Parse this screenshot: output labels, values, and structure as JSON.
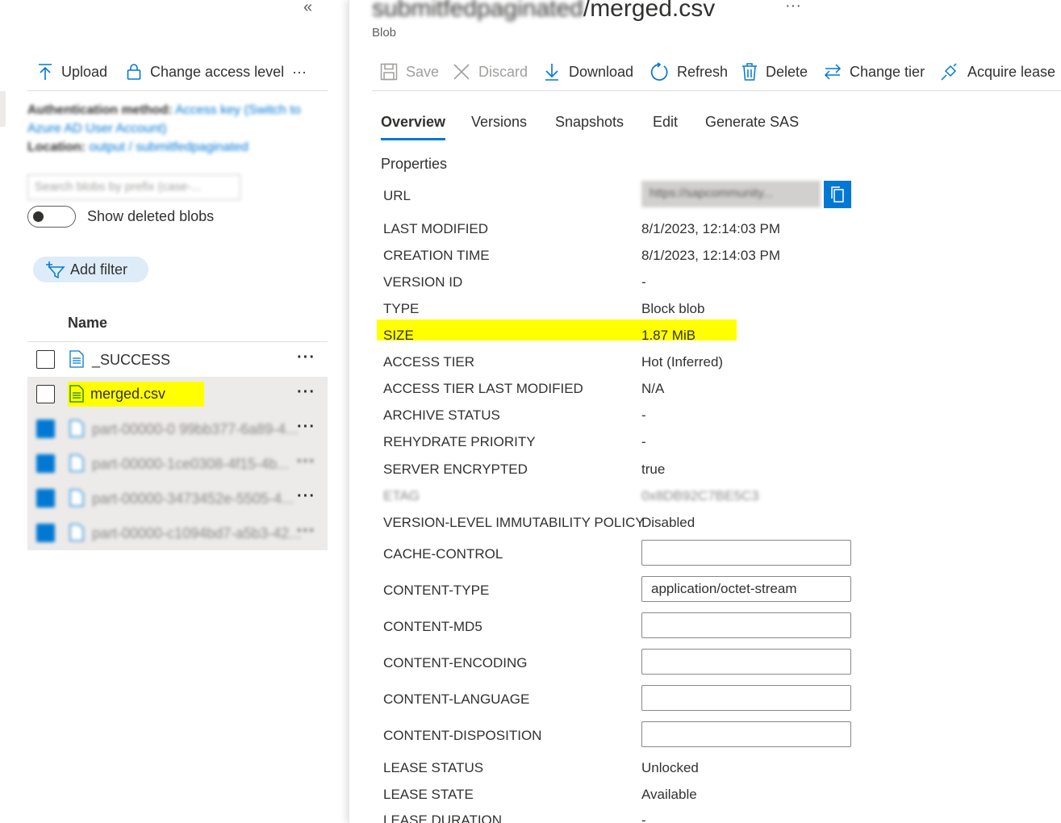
{
  "left": {
    "collapse_glyph": "«",
    "commands": {
      "upload": "Upload",
      "change_access": "Change access level",
      "more": "···"
    },
    "meta": {
      "auth_label": "Authentication method:",
      "auth_value": "Access key (Switch to",
      "auth_value2": "Azure AD User Account)",
      "location_label": "Location:",
      "location_value": "output / submitfedpaginated"
    },
    "search_placeholder": "Search blobs by prefix (case-...",
    "show_deleted": "Show deleted blobs",
    "add_filter": "Add filter",
    "column_name": "Name",
    "files": [
      {
        "name": "_SUCCESS",
        "more": "···"
      },
      {
        "name": "merged.csv",
        "more": "···"
      },
      {
        "name": "part-00000-0 99bb377-6a89-4...",
        "more": "···"
      },
      {
        "name": "part-00000-1ce0308-4f15-4b...",
        "more": "···"
      },
      {
        "name": "part-00000-3473452e-5505-4...",
        "more": "···"
      },
      {
        "name": "part-00000-c1094bd7-a5b3-42...",
        "more": "···"
      }
    ]
  },
  "right": {
    "title_obfuscated": "submitfedpaginated",
    "title_suffix": "/merged.csv",
    "title_more": "···",
    "subtitle": "Blob",
    "commands": {
      "save": "Save",
      "discard": "Discard",
      "download": "Download",
      "refresh": "Refresh",
      "delete": "Delete",
      "change_tier": "Change tier",
      "acquire_lease": "Acquire lease"
    },
    "tabs": [
      "Overview",
      "Versions",
      "Snapshots",
      "Edit",
      "Generate SAS"
    ],
    "properties_title": "Properties",
    "url_label": "URL",
    "url_value": "https://sapcommunity...",
    "props": [
      {
        "label": "LAST MODIFIED",
        "value": "8/1/2023, 12:14:03 PM"
      },
      {
        "label": "CREATION TIME",
        "value": "8/1/2023, 12:14:03 PM"
      },
      {
        "label": "VERSION ID",
        "value": "-"
      },
      {
        "label": "TYPE",
        "value": "Block blob"
      },
      {
        "label": "SIZE",
        "value": "1.87 MiB"
      },
      {
        "label": "ACCESS TIER",
        "value": "Hot (Inferred)"
      },
      {
        "label": "ACCESS TIER LAST MODIFIED",
        "value": "N/A"
      },
      {
        "label": "ARCHIVE STATUS",
        "value": "-"
      },
      {
        "label": "REHYDRATE PRIORITY",
        "value": "-"
      },
      {
        "label": "SERVER ENCRYPTED",
        "value": "true"
      },
      {
        "label": "ETAG",
        "value": "0x8DB92C7BE5C3"
      },
      {
        "label": "VERSION-LEVEL IMMUTABILITY POLICY",
        "value": "Disabled"
      }
    ],
    "editable": [
      {
        "label": "CACHE-CONTROL",
        "value": ""
      },
      {
        "label": "CONTENT-TYPE",
        "value": "application/octet-stream"
      },
      {
        "label": "CONTENT-MD5",
        "value": ""
      },
      {
        "label": "CONTENT-ENCODING",
        "value": ""
      },
      {
        "label": "CONTENT-LANGUAGE",
        "value": ""
      },
      {
        "label": "CONTENT-DISPOSITION",
        "value": ""
      }
    ],
    "lease": [
      {
        "label": "LEASE STATUS",
        "value": "Unlocked"
      },
      {
        "label": "LEASE STATE",
        "value": "Available"
      },
      {
        "label": "LEASE DURATION",
        "value": "-"
      }
    ]
  },
  "colors": {
    "accent": "#0078d4",
    "highlight": "#ffff00",
    "pill": "#deecf9"
  }
}
